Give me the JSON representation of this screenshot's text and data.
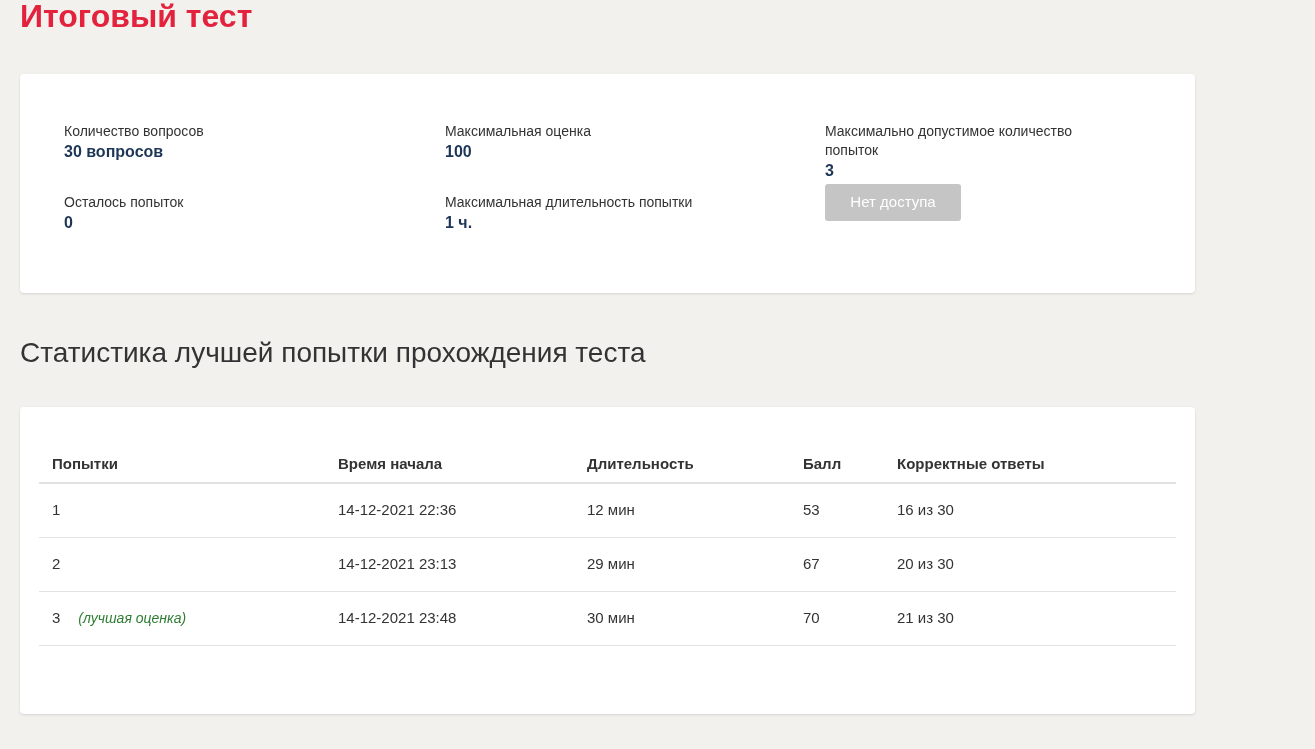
{
  "title": "Итоговый тест",
  "info": [
    {
      "label": "Количество вопросов",
      "value": "30 вопросов"
    },
    {
      "label": "Максимальная оценка",
      "value": "100"
    },
    {
      "label": "Максимально допустимое количество попыток",
      "value": "3"
    },
    {
      "label": "Осталось попыток",
      "value": "0"
    },
    {
      "label": "Максимальная длительность попытки",
      "value": "1 ч."
    }
  ],
  "start_button": {
    "label": "Нет доступа",
    "disabled": true
  },
  "stats_heading": "Статистика лучшей попытки прохождения теста",
  "table": {
    "columns": [
      "Попытки",
      "Время начала",
      "Длительность",
      "Балл",
      "Корректные ответы"
    ],
    "rows": [
      {
        "cells": [
          "1",
          "14-12-2021 22:36",
          "12 мин",
          "53",
          "16 из 30"
        ]
      },
      {
        "cells": [
          "2",
          "14-12-2021 23:13",
          "29 мин",
          "67",
          "20 из 30"
        ]
      },
      {
        "cells": [
          "3",
          "14-12-2021 23:48",
          "30 мин",
          "70",
          "21 из 30"
        ],
        "note": "(лучшая оценка)"
      }
    ]
  }
}
